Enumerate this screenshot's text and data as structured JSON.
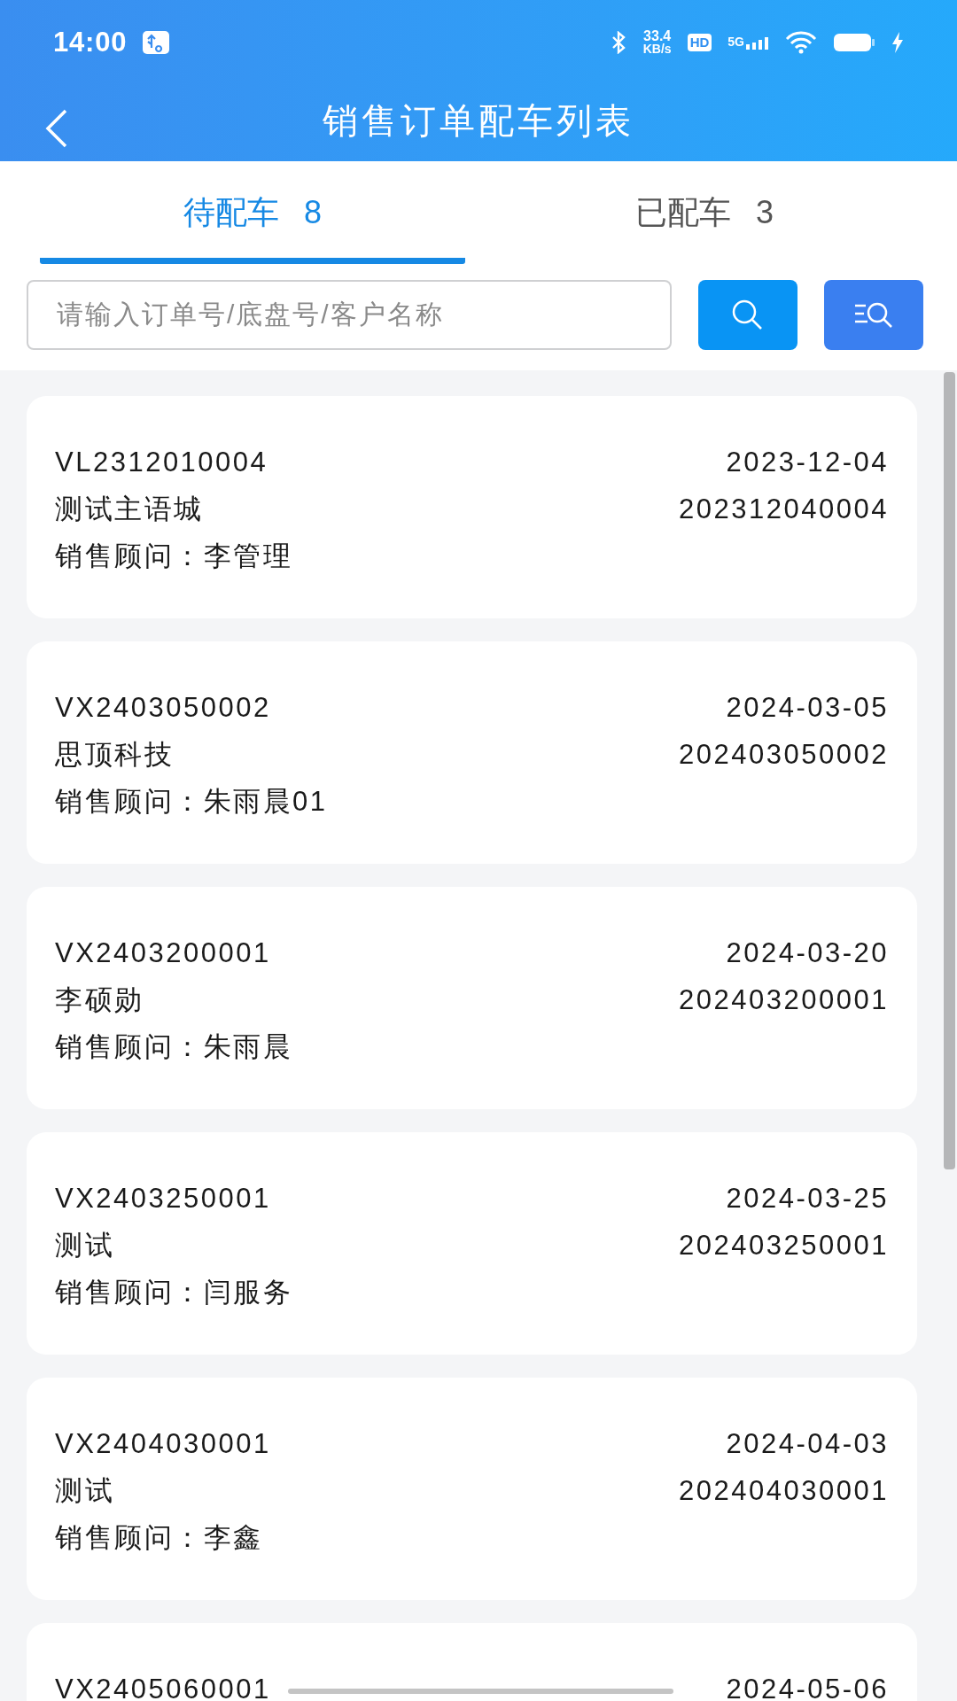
{
  "status_bar": {
    "time": "14:00",
    "net_speed": "33.4",
    "net_unit": "KB/s",
    "hd": "HD",
    "network": "5G"
  },
  "header": {
    "title": "销售订单配车列表"
  },
  "tabs": [
    {
      "label": "待配车",
      "count": "8",
      "selected": true
    },
    {
      "label": "已配车",
      "count": "3",
      "selected": false
    }
  ],
  "search": {
    "placeholder": "请输入订单号/底盘号/客户名称"
  },
  "orders": [
    {
      "order_no": "VL2312010004",
      "date": "2023-12-04",
      "customer": "测试主语城",
      "number": "202312040004",
      "advisor": "销售顾问：李管理"
    },
    {
      "order_no": "VX2403050002",
      "date": "2024-03-05",
      "customer": "思顶科技",
      "number": "202403050002",
      "advisor": "销售顾问：朱雨晨01"
    },
    {
      "order_no": "VX2403200001",
      "date": "2024-03-20",
      "customer": "李硕勋",
      "number": "202403200001",
      "advisor": "销售顾问：朱雨晨"
    },
    {
      "order_no": "VX2403250001",
      "date": "2024-03-25",
      "customer": "测试",
      "number": "202403250001",
      "advisor": "销售顾问：闫服务"
    },
    {
      "order_no": "VX2404030001",
      "date": "2024-04-03",
      "customer": "测试",
      "number": "202404030001",
      "advisor": "销售顾问：李鑫"
    },
    {
      "order_no": "VX2405060001",
      "date": "2024-05-06"
    }
  ]
}
